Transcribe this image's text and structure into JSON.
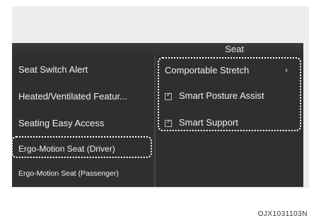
{
  "screen": {
    "title": "Seat"
  },
  "left_menu": {
    "items": [
      {
        "label": "Seat Switch Alert"
      },
      {
        "label": "Heated/Ventilated Featur..."
      },
      {
        "label": "Seating Easy Access"
      },
      {
        "label": "Ergo-Motion Seat (Driver)"
      },
      {
        "label": "Ergo-Motion Seat (Passenger)"
      }
    ],
    "selected_index": 3
  },
  "right_menu": {
    "comportable_stretch": {
      "label": "Comportable Stretch",
      "icon": "chevron-right-icon"
    },
    "smart_posture_assist": {
      "label": "Smart Posture Assist",
      "checked": true
    },
    "smart_support": {
      "label": "Smart Support",
      "checked": true
    }
  },
  "caption": "OJX1031103N"
}
